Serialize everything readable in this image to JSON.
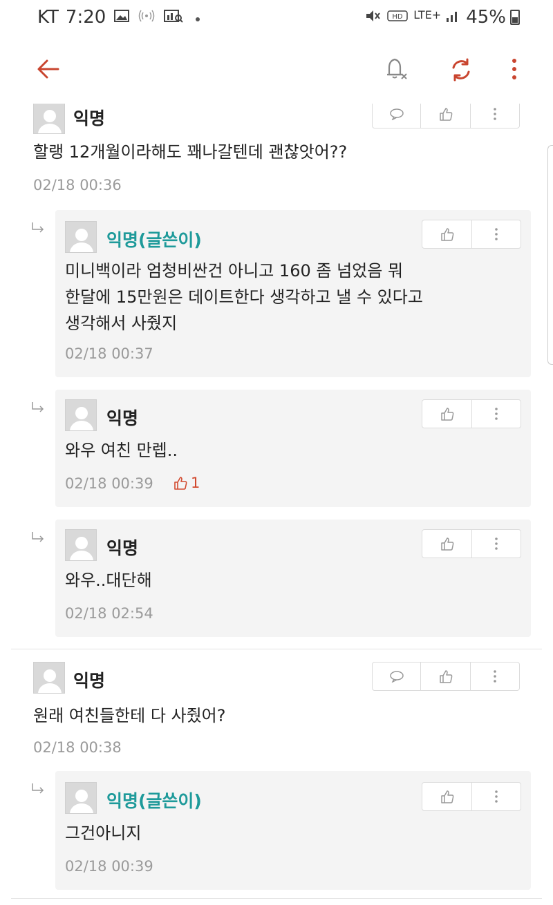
{
  "status": {
    "carrier": "KT",
    "time": "7:20",
    "network": "LTE+",
    "battery": "45%",
    "icons": [
      "image-icon",
      "wifi-hotspot-icon",
      "chart-icon",
      "dot-icon",
      "mute-icon",
      "hd-icon",
      "signal-icon",
      "battery-icon"
    ]
  },
  "appbar": {
    "icons": [
      "back-arrow-icon",
      "notification-off-icon",
      "refresh-icon",
      "more-vertical-icon"
    ],
    "accent": "#c9452f"
  },
  "comments": [
    {
      "author": "익명",
      "text": [
        "할랭 12개월이라해도 꽤나갈텐데 괜찮앗어??"
      ],
      "time": "02/18 00:36",
      "replies": [
        {
          "author": "익명(글쓴이)",
          "text": [
            "미니백이라 엄청비싼건 아니고 160 좀 넘었음 뭐",
            "한달에 15만원은 데이트한다 생각하고 낼 수 있다고",
            "생각해서 사줬지"
          ],
          "time": "02/18 00:37"
        },
        {
          "author": "익명",
          "text": [
            "와우 여친 만렙.."
          ],
          "time": "02/18 00:39",
          "likes": "1"
        },
        {
          "author": "익명",
          "text": [
            "와우..대단해"
          ],
          "time": "02/18 02:54"
        }
      ]
    },
    {
      "author": "익명",
      "text": [
        "원래 여친들한테 다 사줬어?"
      ],
      "time": "02/18 00:38",
      "replies": [
        {
          "author": "익명(글쓴이)",
          "text": [
            "그건아니지"
          ],
          "time": "02/18 00:39"
        }
      ]
    }
  ],
  "colors": {
    "op_author": "#1e9a9a",
    "timestamp": "#9a9a9a",
    "like_count": "#d2492e",
    "reply_background": "#f4f4f4"
  }
}
